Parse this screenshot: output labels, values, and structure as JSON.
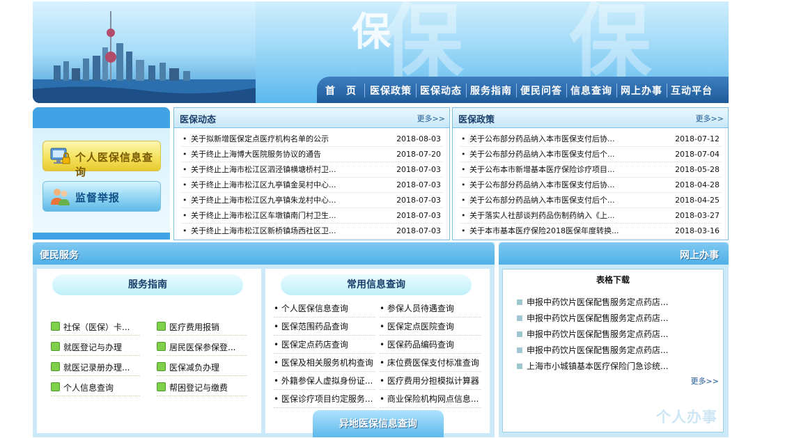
{
  "banner": {
    "bg_word_small": "保",
    "bg_word_1": "保",
    "bg_word_2": "保"
  },
  "nav": [
    "首　页",
    "医保政策",
    "医保动态",
    "服务指南",
    "便民问答",
    "信息查询",
    "网上办事",
    "互动平台"
  ],
  "left_buttons": {
    "personal_query": "个人医保信息查询",
    "report": "监督举报"
  },
  "news": {
    "title": "医保动态",
    "more": "更多>>",
    "items": [
      {
        "title": "关于拟新增医保定点医疗机构名单的公示",
        "date": "2018-08-03"
      },
      {
        "title": "关于终止上海博大医院服务协议的通告",
        "date": "2018-07-20"
      },
      {
        "title": "关于终止上海市松江区泗泾镇横塘桥村卫...",
        "date": "2018-07-03"
      },
      {
        "title": "关于终止上海市松江区九亭镇金吴村中心...",
        "date": "2018-07-03"
      },
      {
        "title": "关于终止上海市松江区九亭镇朱龙村中心...",
        "date": "2018-07-03"
      },
      {
        "title": "关于终止上海市松江区车墩镇南门村卫生...",
        "date": "2018-07-03"
      },
      {
        "title": "关于终止上海市松江区新桥镇场西社区卫...",
        "date": "2018-07-03"
      }
    ]
  },
  "policy": {
    "title": "医保政策",
    "more": "更多>>",
    "items": [
      {
        "title": "关于公布部分药品纳入本市医保支付后协...",
        "date": "2018-07-12"
      },
      {
        "title": "关于公布部分药品纳入本市医保支付后个...",
        "date": "2018-07-04"
      },
      {
        "title": "关于公布本市新增基本医疗保险诊疗项目...",
        "date": "2018-05-28"
      },
      {
        "title": "关于公布部分药品纳入本市医保支付后协...",
        "date": "2018-04-28"
      },
      {
        "title": "关于公布部分药品纳入本市医保支付后个...",
        "date": "2018-04-25"
      },
      {
        "title": "关于落实人社部谈判药品伤制药纳入《上...",
        "date": "2018-03-27"
      },
      {
        "title": "关于本市基本医疗保险2018医保年度转换...",
        "date": "2018-03-16"
      }
    ]
  },
  "services": {
    "title": "便民服务",
    "guide_title": "服务指南",
    "guide_items": [
      "社保（医保）卡...",
      "医疗费用报销",
      "就医登记与办理",
      "居民医保参保登...",
      "就医记录册办理...",
      "医保减负办理",
      "个人信息查询",
      "帮困登记与缴费"
    ],
    "query_title": "常用信息查询",
    "query_items": [
      "个人医保信息查询",
      "参保人员待遇查询",
      "医保范围药品查询",
      "医保定点医院查询",
      "医保定点药店查询",
      "医保药品编码查询",
      "医保及相关服务机构查询",
      "床位费医保支付标准查询",
      "外籍参保人虚拟身份证...",
      "医疗费用分担模拟计算器",
      "医保诊疗项目约定服务...",
      "商业保险机构网点信息..."
    ],
    "remote_button": "异地医保信息查询"
  },
  "online": {
    "title": "网上办事",
    "forms_title": "表格下载",
    "items": [
      "申报中药饮片医保配售服务定点药店...",
      "申报中药饮片医保配售服务定点药店...",
      "申报中药饮片医保配售服务定点药店...",
      "申报中药饮片医保配售服务定点药店...",
      "上海市小城镇基本医疗保险门急诊统..."
    ],
    "more": "更多>>",
    "watermark": "个人办事"
  }
}
